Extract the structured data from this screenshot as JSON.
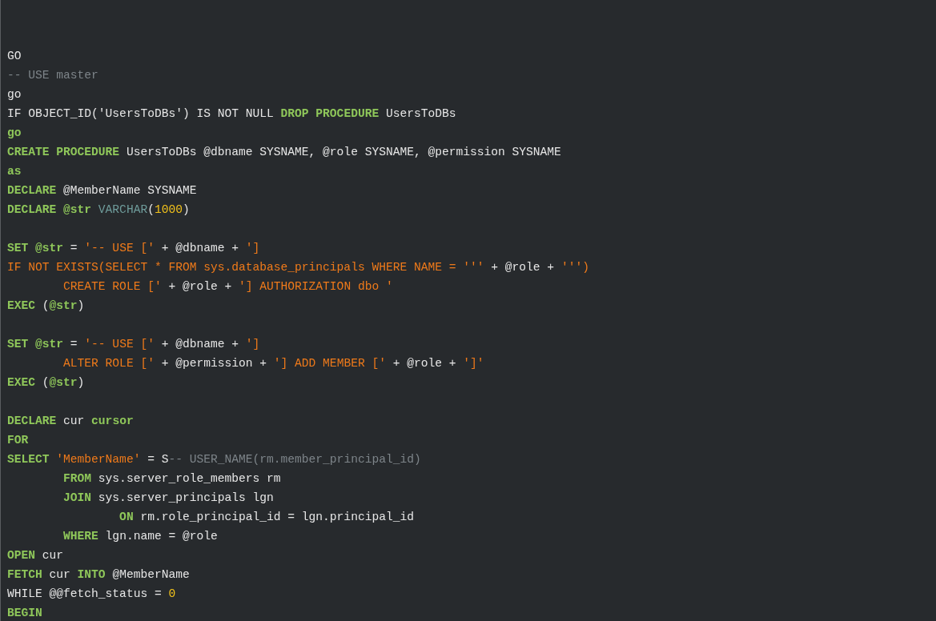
{
  "code_block": {
    "lines": [
      {
        "kind": "code",
        "tokens": [
          {
            "kind": "plain",
            "text": "GO"
          }
        ]
      },
      {
        "kind": "code",
        "tokens": [
          {
            "kind": "comment",
            "text": "-- USE master"
          }
        ]
      },
      {
        "kind": "code",
        "tokens": [
          {
            "kind": "plain",
            "text": "go"
          }
        ]
      },
      {
        "kind": "code",
        "tokens": [
          {
            "kind": "plain",
            "text": "IF OBJECT_ID('UsersToDBs') IS NOT NULL "
          },
          {
            "kind": "keyword",
            "text": "DROP PROCEDURE"
          },
          {
            "kind": "plain",
            "text": " UsersToDBs"
          }
        ]
      },
      {
        "kind": "code",
        "tokens": [
          {
            "kind": "keyword",
            "text": "go"
          }
        ]
      },
      {
        "kind": "code",
        "tokens": [
          {
            "kind": "keyword",
            "text": "CREATE PROCEDURE"
          },
          {
            "kind": "plain",
            "text": " UsersToDBs @dbname SYSNAME, @role SYSNAME, @permission SYSNAME"
          }
        ]
      },
      {
        "kind": "code",
        "tokens": [
          {
            "kind": "keyword",
            "text": "as"
          }
        ]
      },
      {
        "kind": "code",
        "tokens": [
          {
            "kind": "keyword",
            "text": "DECLARE"
          },
          {
            "kind": "plain",
            "text": " @MemberName SYSNAME"
          }
        ]
      },
      {
        "kind": "code",
        "tokens": [
          {
            "kind": "keyword",
            "text": "DECLARE @str"
          },
          {
            "kind": "type",
            "text": " VARCHAR"
          },
          {
            "kind": "plain",
            "text": "("
          },
          {
            "kind": "number",
            "text": "1000"
          },
          {
            "kind": "plain",
            "text": ")"
          }
        ]
      },
      {
        "kind": "blank"
      },
      {
        "kind": "code",
        "tokens": [
          {
            "kind": "keyword",
            "text": "SET @str"
          },
          {
            "kind": "plain",
            "text": " = "
          },
          {
            "kind": "string",
            "text": "'-- USE ['"
          },
          {
            "kind": "plain",
            "text": " + @dbname + "
          },
          {
            "kind": "string",
            "text": "']"
          }
        ]
      },
      {
        "kind": "code",
        "tokens": [
          {
            "kind": "string",
            "text": "IF NOT EXISTS(SELECT * FROM sys.database_principals WHERE NAME = '''"
          },
          {
            "kind": "plain",
            "text": " + @role + "
          },
          {
            "kind": "string",
            "text": "''')"
          }
        ]
      },
      {
        "kind": "code",
        "tokens": [
          {
            "kind": "string",
            "text": "        CREATE ROLE ['"
          },
          {
            "kind": "plain",
            "text": " + @role + "
          },
          {
            "kind": "string",
            "text": "'] AUTHORIZATION dbo '"
          }
        ]
      },
      {
        "kind": "code",
        "tokens": [
          {
            "kind": "keyword",
            "text": "EXEC"
          },
          {
            "kind": "plain",
            "text": " ("
          },
          {
            "kind": "keyword",
            "text": "@str"
          },
          {
            "kind": "plain",
            "text": ")"
          }
        ]
      },
      {
        "kind": "blank"
      },
      {
        "kind": "code",
        "tokens": [
          {
            "kind": "keyword",
            "text": "SET @str"
          },
          {
            "kind": "plain",
            "text": " = "
          },
          {
            "kind": "string",
            "text": "'-- USE ['"
          },
          {
            "kind": "plain",
            "text": " + @dbname + "
          },
          {
            "kind": "string",
            "text": "']"
          }
        ]
      },
      {
        "kind": "code",
        "tokens": [
          {
            "kind": "string",
            "text": "        ALTER ROLE ['"
          },
          {
            "kind": "plain",
            "text": " + @permission + "
          },
          {
            "kind": "string",
            "text": "'] ADD MEMBER ['"
          },
          {
            "kind": "plain",
            "text": " + @role + "
          },
          {
            "kind": "string",
            "text": "']'"
          }
        ]
      },
      {
        "kind": "code",
        "tokens": [
          {
            "kind": "keyword",
            "text": "EXEC"
          },
          {
            "kind": "plain",
            "text": " ("
          },
          {
            "kind": "keyword",
            "text": "@str"
          },
          {
            "kind": "plain",
            "text": ")"
          }
        ]
      },
      {
        "kind": "blank"
      },
      {
        "kind": "code",
        "tokens": [
          {
            "kind": "keyword",
            "text": "DECLARE"
          },
          {
            "kind": "plain",
            "text": " cur "
          },
          {
            "kind": "keyword",
            "text": "cursor"
          }
        ]
      },
      {
        "kind": "code",
        "tokens": [
          {
            "kind": "keyword",
            "text": "FOR"
          }
        ]
      },
      {
        "kind": "code",
        "tokens": [
          {
            "kind": "keyword",
            "text": "SELECT"
          },
          {
            "kind": "string",
            "text": " 'MemberName'"
          },
          {
            "kind": "plain",
            "text": " = S"
          },
          {
            "kind": "comment",
            "text": "-- USER_NAME(rm.member_principal_id)"
          }
        ]
      },
      {
        "kind": "code",
        "tokens": [
          {
            "kind": "keyword",
            "text": "        FROM"
          },
          {
            "kind": "plain",
            "text": " sys.server_role_members rm"
          }
        ]
      },
      {
        "kind": "code",
        "tokens": [
          {
            "kind": "keyword",
            "text": "        JOIN"
          },
          {
            "kind": "plain",
            "text": " sys.server_principals lgn"
          }
        ]
      },
      {
        "kind": "code",
        "tokens": [
          {
            "kind": "keyword",
            "text": "                ON"
          },
          {
            "kind": "plain",
            "text": " rm.role_principal_id = lgn.principal_id"
          }
        ]
      },
      {
        "kind": "code",
        "tokens": [
          {
            "kind": "keyword",
            "text": "        WHERE"
          },
          {
            "kind": "plain",
            "text": " lgn.name = @role"
          }
        ]
      },
      {
        "kind": "code",
        "tokens": [
          {
            "kind": "keyword",
            "text": "OPEN"
          },
          {
            "kind": "plain",
            "text": " cur"
          }
        ]
      },
      {
        "kind": "code",
        "tokens": [
          {
            "kind": "keyword",
            "text": "FETCH"
          },
          {
            "kind": "plain",
            "text": " cur "
          },
          {
            "kind": "keyword",
            "text": "INTO"
          },
          {
            "kind": "plain",
            "text": " @MemberName"
          }
        ]
      },
      {
        "kind": "code",
        "tokens": [
          {
            "kind": "plain",
            "text": "WHILE @@fetch_status = "
          },
          {
            "kind": "number",
            "text": "0"
          }
        ]
      },
      {
        "kind": "code",
        "tokens": [
          {
            "kind": "keyword",
            "text": "BEGIN"
          }
        ]
      }
    ]
  }
}
